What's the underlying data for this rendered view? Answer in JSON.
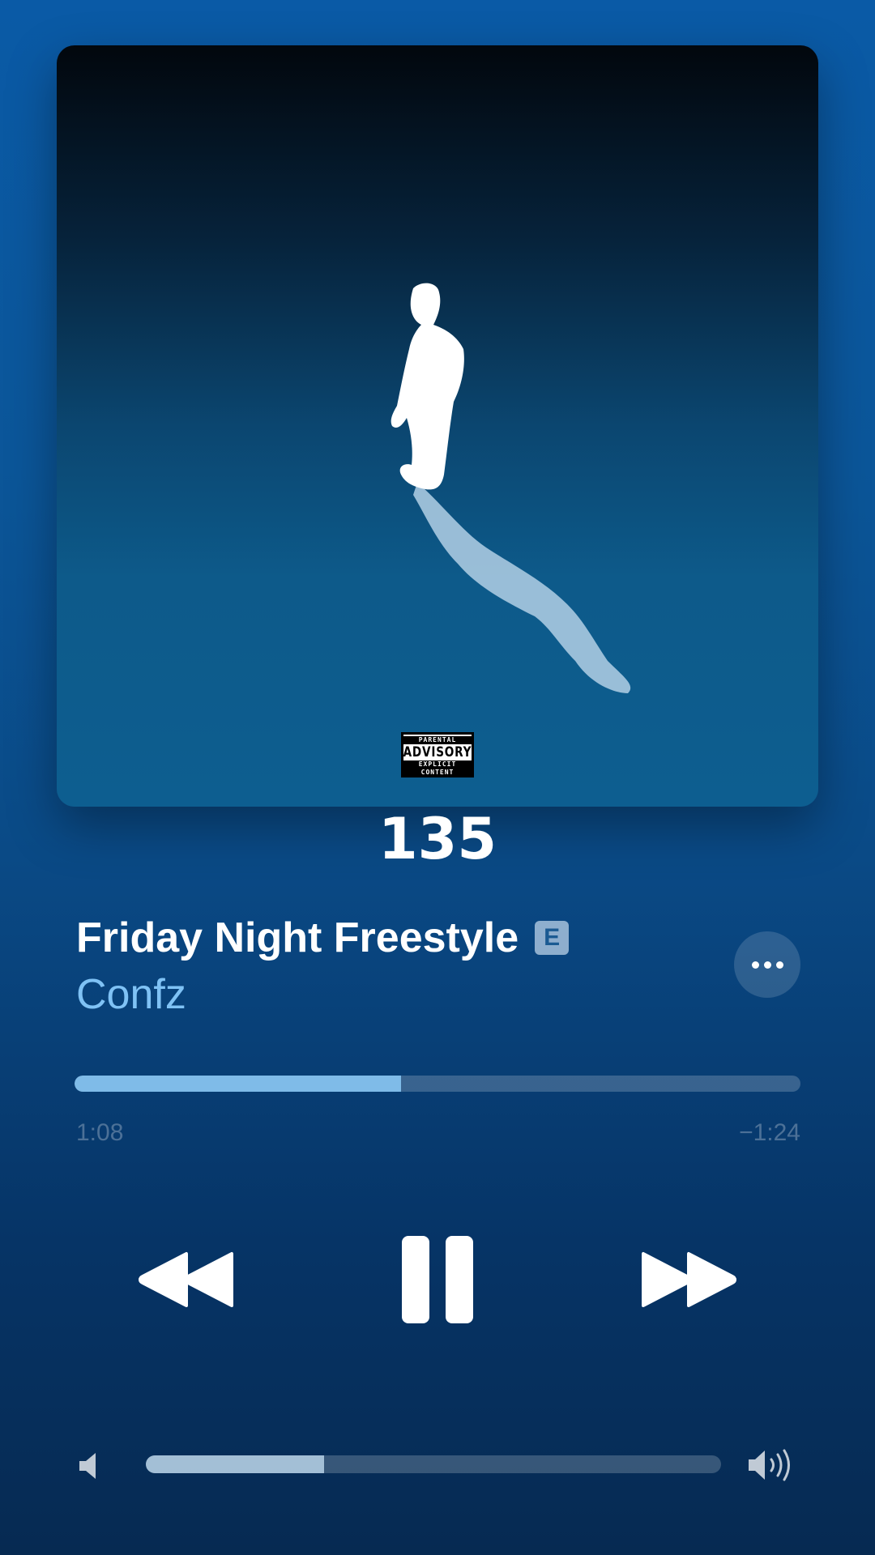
{
  "artwork": {
    "advisory": {
      "top": "PARENTAL",
      "middle": "ADVISORY",
      "bottom": "EXPLICIT CONTENT"
    }
  },
  "overlay_number": "135",
  "track": {
    "title": "Friday Night Freestyle",
    "explicit_badge": "E",
    "artist": "Confz"
  },
  "playback": {
    "elapsed": "1:08",
    "remaining": "−1:24",
    "progress_fraction": 0.45,
    "state": "playing"
  },
  "volume": {
    "level_fraction": 0.31
  },
  "colors": {
    "accent": "#7fc2f5",
    "progress_fill": "#7fbbe8",
    "background_top": "#0a5aa6",
    "background_bottom": "#062a52"
  },
  "icons": {
    "more": "ellipsis-icon",
    "rewind": "rewind-icon",
    "pause": "pause-icon",
    "forward": "fast-forward-icon",
    "volume_low": "speaker-low-icon",
    "volume_high": "speaker-high-icon"
  }
}
